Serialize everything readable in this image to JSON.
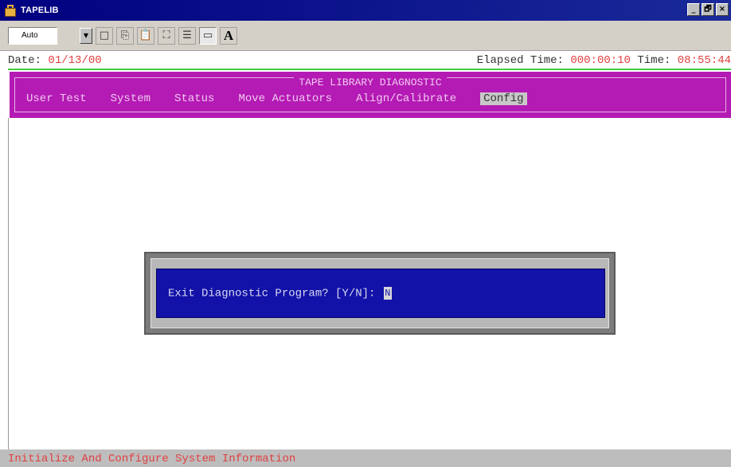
{
  "window": {
    "title": "TAPELIB",
    "controls": {
      "minimize": "_",
      "maximize": "🗗",
      "close": "×"
    }
  },
  "toolbar": {
    "font_size_value": "Auto",
    "letter_button": "A",
    "icons": [
      "blank-page-icon",
      "copy-icon",
      "paste-icon",
      "full-screen-icon",
      "properties-icon",
      "window-icon",
      "font-icon"
    ]
  },
  "info": {
    "date_label": "Date: ",
    "date_value": "01/13/00",
    "elapsed_label": "Elapsed Time: ",
    "elapsed_value": "000:00:10",
    "time_label": " Time: ",
    "time_value": "08:55:44"
  },
  "menu": {
    "title": "TAPE LIBRARY DIAGNOSTIC",
    "items": [
      {
        "label": "User Test"
      },
      {
        "label": "System"
      },
      {
        "label": "Status"
      },
      {
        "label": "Move Actuators"
      },
      {
        "label": "Align/Calibrate"
      },
      {
        "label": "Config"
      }
    ],
    "selected": "Config"
  },
  "dialog": {
    "prompt": "Exit Diagnostic Program? [Y/N]: ",
    "input_value": "N"
  },
  "status_bar": {
    "text": "Initialize And Configure System Information"
  },
  "colors": {
    "titlebar": "#000080",
    "menu_bg": "#b41ab4",
    "dialog_bg": "#1212a8",
    "value_red": "#e04040",
    "divider_green": "#44cc44"
  }
}
